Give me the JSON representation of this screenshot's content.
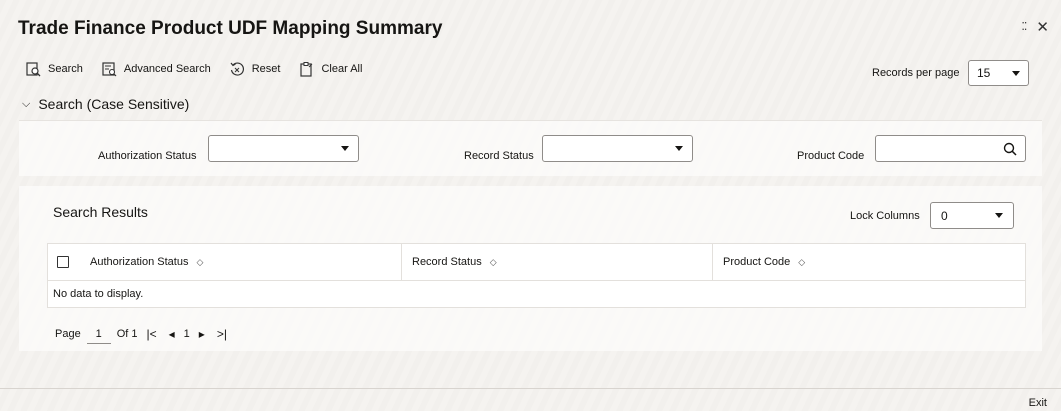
{
  "window": {
    "title": "Trade Finance Product UDF Mapping Summary"
  },
  "toolbar": {
    "search_label": "Search",
    "advanced_search_label": "Advanced Search",
    "reset_label": "Reset",
    "clear_all_label": "Clear All",
    "records_per_page_label": "Records per page",
    "records_per_page_value": "15"
  },
  "search_section": {
    "title": "Search (Case Sensitive)",
    "authorization_status_label": "Authorization Status",
    "authorization_status_value": "",
    "record_status_label": "Record Status",
    "record_status_value": "",
    "product_code_label": "Product Code",
    "product_code_value": ""
  },
  "results": {
    "title": "Search Results",
    "lock_columns_label": "Lock Columns",
    "lock_columns_value": "0",
    "columns": [
      "Authorization Status",
      "Record Status",
      "Product Code"
    ],
    "empty_message": "No data to display."
  },
  "pagination": {
    "page_label": "Page",
    "current_page": "1",
    "of_label": "Of 1",
    "page_number": "1"
  },
  "footer": {
    "exit_label": "Exit"
  }
}
